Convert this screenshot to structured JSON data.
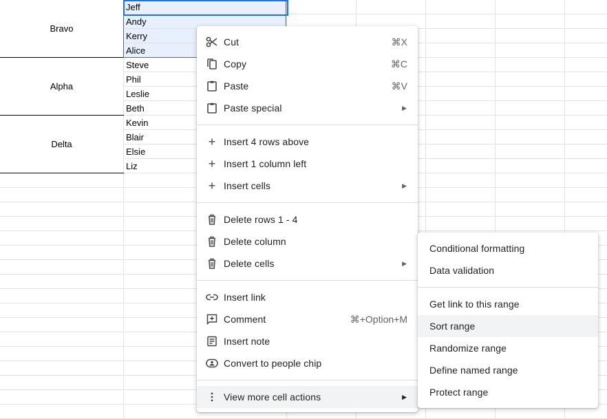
{
  "sheet": {
    "groups": [
      {
        "label": "Bravo",
        "names": [
          "Jeff",
          "Andy",
          "Kerry",
          "Alice"
        ]
      },
      {
        "label": "Alpha",
        "names": [
          "Steve",
          "Phil",
          "Leslie",
          "Beth"
        ]
      },
      {
        "label": "Delta",
        "names": [
          "Kevin",
          "Blair",
          "Elsie",
          "Liz"
        ]
      }
    ]
  },
  "context_menu": {
    "cut": {
      "label": "Cut",
      "shortcut": "⌘X"
    },
    "copy": {
      "label": "Copy",
      "shortcut": "⌘C"
    },
    "paste": {
      "label": "Paste",
      "shortcut": "⌘V"
    },
    "paste_special": {
      "label": "Paste special"
    },
    "insert_rows": {
      "label": "Insert 4 rows above"
    },
    "insert_column": {
      "label": "Insert 1 column left"
    },
    "insert_cells": {
      "label": "Insert cells"
    },
    "delete_rows": {
      "label": "Delete rows 1 - 4"
    },
    "delete_column": {
      "label": "Delete column"
    },
    "delete_cells": {
      "label": "Delete cells"
    },
    "insert_link": {
      "label": "Insert link"
    },
    "comment": {
      "label": "Comment",
      "shortcut": "⌘+Option+M"
    },
    "insert_note": {
      "label": "Insert note"
    },
    "people_chip": {
      "label": "Convert to people chip"
    },
    "more_actions": {
      "label": "View more cell actions"
    }
  },
  "submenu": {
    "items": [
      "Conditional formatting",
      "Data validation",
      "Get link to this range",
      "Sort range",
      "Randomize range",
      "Define named range",
      "Protect range"
    ],
    "highlighted": "Sort range"
  },
  "colors": {
    "selection_border": "#1a73e8",
    "selection_fill": "#e8f0fe",
    "menu_hover": "#f1f3f4",
    "gridline": "#e2e3e3"
  }
}
